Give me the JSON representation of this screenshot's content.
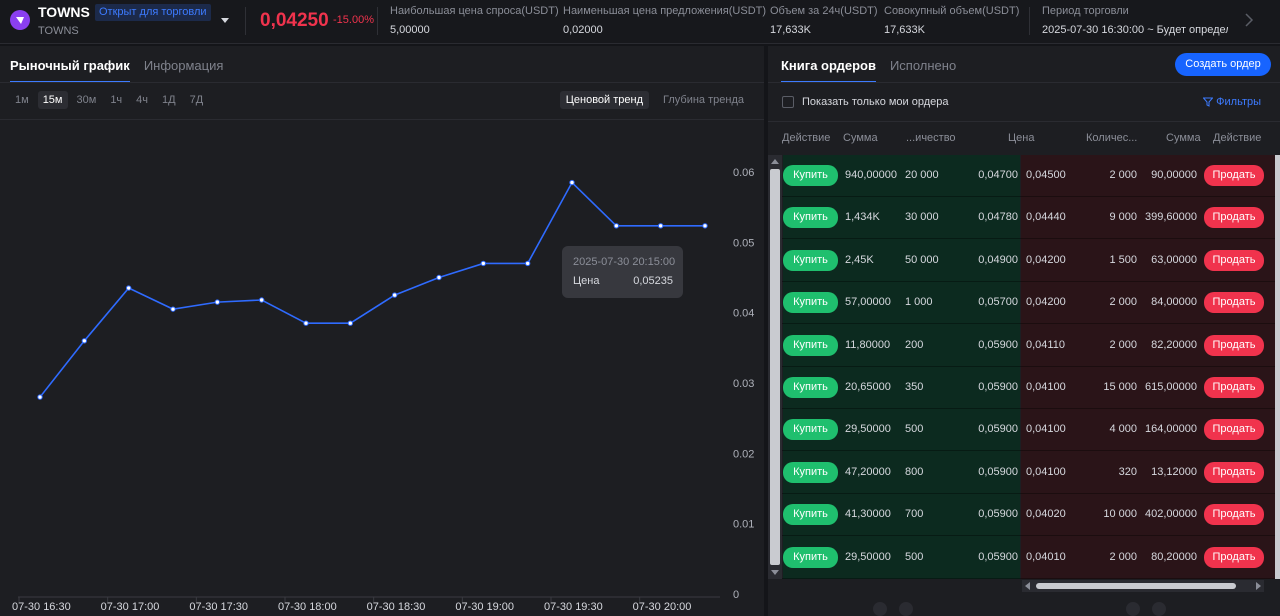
{
  "header": {
    "token_name": "TOWNS",
    "token_status": "Открыт для торговли",
    "token_sub": "TOWNS",
    "price": "0,04250",
    "change": "-15.00%",
    "stats": [
      {
        "label": "Наибольшая цена спроса(USDT)",
        "value": "5,00000"
      },
      {
        "label": "Наименьшая цена предложения(USDT)",
        "value": "0,02000"
      },
      {
        "label": "Объем за 24ч(USDT)",
        "value": "17,633K"
      },
      {
        "label": "Совокупный объем(USDT)",
        "value": "17,633K"
      },
      {
        "label": "Период торговли",
        "value": "2025-07-30 16:30:00 ~ Будет определен"
      }
    ]
  },
  "left_panel": {
    "tabs": [
      {
        "label": "Рыночный график",
        "active": true
      },
      {
        "label": "Информация",
        "active": false
      }
    ],
    "timeframes": [
      {
        "label": "1м",
        "active": false
      },
      {
        "label": "15м",
        "active": true
      },
      {
        "label": "30м",
        "active": false
      },
      {
        "label": "1ч",
        "active": false
      },
      {
        "label": "4ч",
        "active": false
      },
      {
        "label": "1Д",
        "active": false
      },
      {
        "label": "7Д",
        "active": false
      }
    ],
    "modes": [
      {
        "label": "Ценовой тренд",
        "active": true
      },
      {
        "label": "Глубина тренда",
        "active": false
      }
    ]
  },
  "chart_data": {
    "type": "line",
    "x": [
      "07-30 16:30",
      "07-30 16:45",
      "07-30 17:00",
      "07-30 17:15",
      "07-30 17:30",
      "07-30 17:45",
      "07-30 18:00",
      "07-30 18:15",
      "07-30 18:30",
      "07-30 18:45",
      "07-30 19:00",
      "07-30 19:15",
      "07-30 19:30",
      "07-30 19:45",
      "07-30 20:00",
      "07-30 20:15"
    ],
    "values": [
      0.028,
      0.036,
      0.0435,
      0.0405,
      0.0415,
      0.0418,
      0.0385,
      0.0385,
      0.0425,
      0.045,
      0.047,
      0.047,
      0.0585,
      0.05235,
      0.05235,
      0.05235
    ],
    "x_tick_labels": [
      "07-30 16:30",
      "07-30 17:00",
      "07-30 17:30",
      "07-30 18:00",
      "07-30 18:30",
      "07-30 19:00",
      "07-30 19:30",
      "07-30 20:00"
    ],
    "y_tick_labels": [
      "0",
      "0.01",
      "0.02",
      "0.03",
      "0.04",
      "0.05",
      "0.06"
    ],
    "ylim": [
      0,
      0.06
    ],
    "y_axis_position": "right",
    "color": "#2f6bff",
    "tooltip": {
      "time": "2025-07-30 20:15:00",
      "label": "Цена",
      "value": "0,05235"
    }
  },
  "right_panel": {
    "tabs": [
      {
        "label": "Книга ордеров",
        "active": true
      },
      {
        "label": "Исполнено",
        "active": false
      }
    ],
    "create_button": "Создать ордер",
    "only_mine_label": "Показать только мои ордера",
    "filters_label": "Фильтры",
    "columns": {
      "buy_action": "Действие",
      "buy_sum": "Сумма",
      "buy_qty": "...ичество",
      "price": "Цена",
      "sell_qty": "Количес...",
      "sell_sum": "Сумма",
      "sell_action": "Действие"
    },
    "buy_label": "Купить",
    "sell_label": "Продать",
    "rows": [
      {
        "buy_sum": "940,00000",
        "buy_qty": "20 000",
        "buy_price": "0,04700",
        "sell_price": "0,04500",
        "sell_qty": "2 000",
        "sell_sum": "90,00000"
      },
      {
        "buy_sum": "1,434K",
        "buy_qty": "30 000",
        "buy_price": "0,04780",
        "sell_price": "0,04440",
        "sell_qty": "9 000",
        "sell_sum": "399,60000"
      },
      {
        "buy_sum": "2,45K",
        "buy_qty": "50 000",
        "buy_price": "0,04900",
        "sell_price": "0,04200",
        "sell_qty": "1 500",
        "sell_sum": "63,00000"
      },
      {
        "buy_sum": "57,00000",
        "buy_qty": "1 000",
        "buy_price": "0,05700",
        "sell_price": "0,04200",
        "sell_qty": "2 000",
        "sell_sum": "84,00000"
      },
      {
        "buy_sum": "11,80000",
        "buy_qty": "200",
        "buy_price": "0,05900",
        "sell_price": "0,04110",
        "sell_qty": "2 000",
        "sell_sum": "82,20000"
      },
      {
        "buy_sum": "20,65000",
        "buy_qty": "350",
        "buy_price": "0,05900",
        "sell_price": "0,04100",
        "sell_qty": "15 000",
        "sell_sum": "615,00000"
      },
      {
        "buy_sum": "29,50000",
        "buy_qty": "500",
        "buy_price": "0,05900",
        "sell_price": "0,04100",
        "sell_qty": "4 000",
        "sell_sum": "164,00000"
      },
      {
        "buy_sum": "47,20000",
        "buy_qty": "800",
        "buy_price": "0,05900",
        "sell_price": "0,04100",
        "sell_qty": "320",
        "sell_sum": "13,12000"
      },
      {
        "buy_sum": "41,30000",
        "buy_qty": "700",
        "buy_price": "0,05900",
        "sell_price": "0,04020",
        "sell_qty": "10 000",
        "sell_sum": "402,00000"
      },
      {
        "buy_sum": "29,50000",
        "buy_qty": "500",
        "buy_price": "0,05900",
        "sell_price": "0,04010",
        "sell_qty": "2 000",
        "sell_sum": "80,20000"
      }
    ]
  }
}
